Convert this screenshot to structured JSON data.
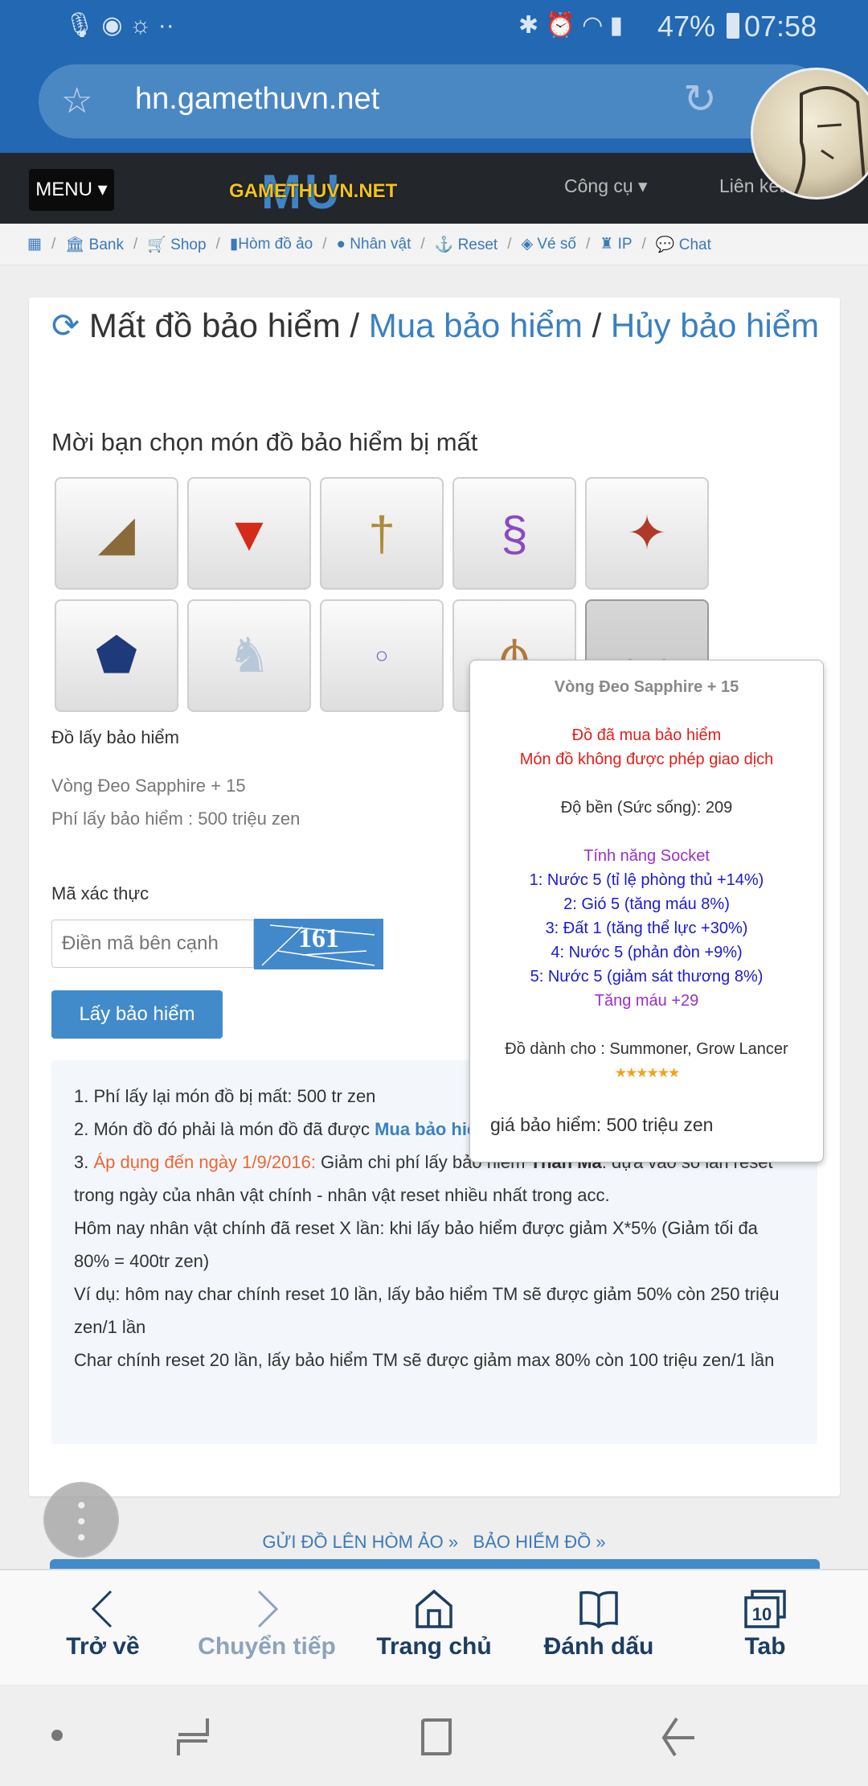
{
  "status": {
    "battery": "47%",
    "time": "07:58"
  },
  "browser": {
    "url": "hn.gamethuvn.net"
  },
  "nav": {
    "menu": "MENU",
    "logo": "GAMETHUVN.NET",
    "tools": "Công cụ",
    "links": "Liên kết"
  },
  "breadcrumb": [
    "Bank",
    "Shop",
    "Hòm đồ ảo",
    "Nhân vật",
    "Reset",
    "Vé số",
    "IP",
    "Chat"
  ],
  "page": {
    "title_part1": "Mất đồ bảo hiểm",
    "sep": " / ",
    "title_link1": "Mua bảo hiểm",
    "title_link2": "Hủy bảo hiểm",
    "choose": "Mời bạn chọn món đồ bảo hiểm bị mất",
    "items": [
      "horn",
      "red-cape",
      "staff",
      "mermaid-pet",
      "red-wings",
      "dragon-shield",
      "pegasus",
      "ring",
      "pendant",
      "sapphire-necklace"
    ],
    "selected_index": 9,
    "section": "Đồ lấy bảo hiểm",
    "item_name": "Vòng Đeo Sapphire + 15",
    "fee": "Phí lấy bảo hiểm : 500 triệu zen",
    "captcha_label": "Mã xác thực",
    "captcha_placeholder": "Điền mã bên cạnh",
    "captcha_code": "161",
    "submit": "Lấy bảo hiểm"
  },
  "info": {
    "l1": "1. Phí lấy lại món đồ bị mất: 500 tr zen",
    "l2a": "2. Món đồ đó phải là món đồ đã được ",
    "l2b": "Mua bảo hiểm",
    "l3a": "3. ",
    "l3b": "Áp dụng đến ngày 1/9/2016:",
    "l3c": " Giảm chi phí lấy bảo hiểm ",
    "l3d": "Thần Mã",
    "l3e": ": dựa vào số lần reset trong ngày của nhân vật chính - nhân vật reset nhiều nhất trong acc.",
    "l4": "Hôm nay nhân vật chính đã reset X lần: khi lấy bảo hiểm được giảm X*5% (Giảm tối đa 80% = 400tr zen)",
    "l5": "Ví dụ: hôm nay char chính reset 10 lần, lấy bảo hiểm TM sẽ được giảm 50% còn 250 triệu zen/1 lần",
    "l6": "Char chính reset 20 lần, lấy bảo hiểm TM sẽ được giảm max 80% còn 100 triệu zen/1 lần"
  },
  "tooltip": {
    "name": "Vòng Đeo Sapphire + 15",
    "warn1": "Đồ đã mua bảo hiểm",
    "warn2": "Món đồ không được phép giao dịch",
    "durability": "Độ bền (Sức sống): 209",
    "socket_title": "Tính năng Socket",
    "sockets": [
      "1: Nước 5 (tỉ lệ phòng thủ +14%)",
      "2: Gió 5 (tăng máu 8%)",
      "3: Đất 1 (tăng thể lực +30%)",
      "4: Nước 5 (phản đòn +9%)",
      "5: Nước 5 (giảm sát thương 8%)"
    ],
    "bonus": "Tăng máu +29",
    "for": "Đồ dành cho : Summoner, Grow Lancer",
    "stars": 6,
    "price": "giá bảo hiểm: 500 triệu zen"
  },
  "footer": {
    "link1": "GỬI ĐỒ LÊN HÒM ẢO",
    "link2": "BẢO HIỂM ĐỒ",
    "chev": "»"
  },
  "bottom_nav": {
    "back": "Trở về",
    "forward": "Chuyển tiếp",
    "home": "Trang chủ",
    "bookmarks": "Đánh dấu",
    "tabs": "Tab",
    "tab_count": "10"
  },
  "colors": {
    "brand_blue": "#2268b3",
    "link": "#3a80c2",
    "button": "#428bca",
    "warn_red": "#e0201a",
    "socket_blue": "#1a1ad0",
    "purple": "#9b30c9",
    "orange": "#ee6633"
  }
}
